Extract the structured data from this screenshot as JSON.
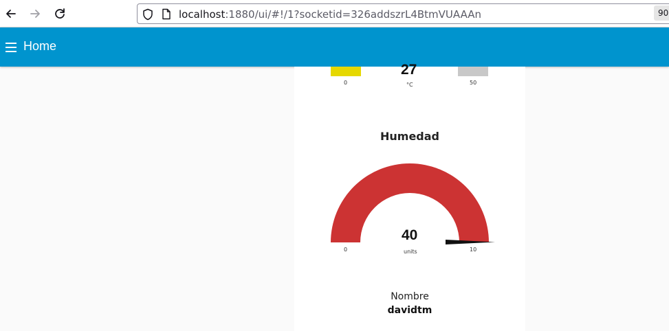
{
  "browser": {
    "url_host": "localhost",
    "url_rest": ":1880/ui/#!/1?socketid=326addszrL4BtmVUAAAn",
    "zoom": "90"
  },
  "header": {
    "title": "Home"
  },
  "temp_gauge": {
    "value": 27,
    "units": "°C",
    "min_label": "0",
    "max_label": "50",
    "colors": {
      "low": "#e6d800",
      "track": "#c8c8c8"
    }
  },
  "humidity_gauge": {
    "title": "Humedad",
    "value": 40,
    "units": "units",
    "min_label": "0",
    "max_label": "10",
    "colors": {
      "fill": "#cc3333"
    }
  },
  "name_text": {
    "label": "Nombre",
    "value": "davidtm"
  }
}
